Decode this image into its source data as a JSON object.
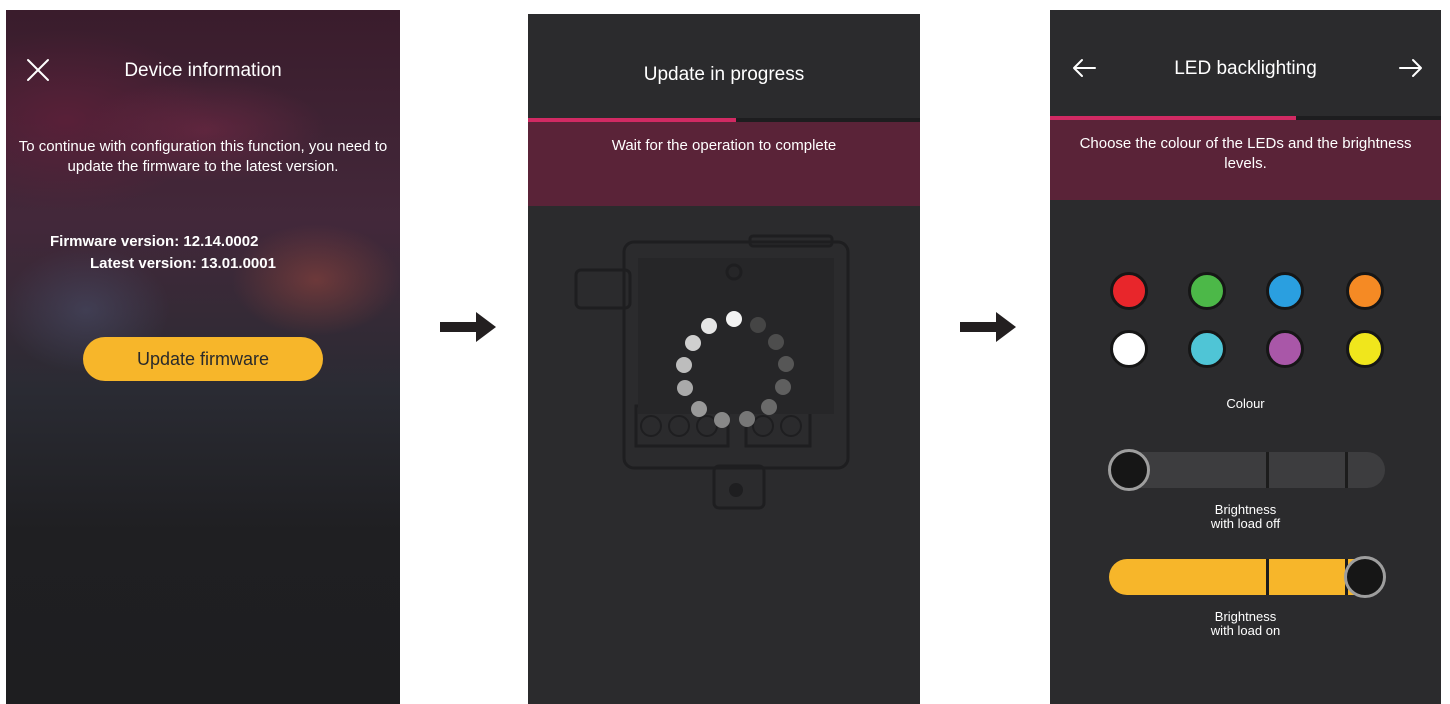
{
  "screen1": {
    "title": "Device information",
    "message": "To continue with configuration this function, you need to update the firmware to the latest version.",
    "firmware_version": "Firmware version: 12.14.0002",
    "latest_version": "Latest version: 13.01.0001",
    "update_button": "Update firmware",
    "close_icon": "close-icon"
  },
  "screen2": {
    "title": "Update in progress",
    "banner_text": "Wait for the operation to complete",
    "progress": 0.53,
    "spinner_icon": "loading-spinner-icon"
  },
  "screen3": {
    "title": "LED backlighting",
    "instructions": "Choose the colour of the LEDs and the brightness levels.",
    "progress": 0.63,
    "back_icon": "arrow-left-icon",
    "next_icon": "arrow-right-icon",
    "colour_label": "Colour",
    "colours": [
      "#e8262b",
      "#4cb848",
      "#2a9fe0",
      "#f58a24",
      "#ffffff",
      "#4fc5d6",
      "#a957a8",
      "#f0e61c"
    ],
    "brightness_off_label_1": "Brightness",
    "brightness_off_label_2": "with load off",
    "brightness_off_level": 0,
    "brightness_on_label_1": "Brightness",
    "brightness_on_label_2": "with load on",
    "brightness_on_level": 1
  },
  "flow_arrow_icon": "arrow-right-icon",
  "accent_color": "#d12a63",
  "button_color": "#f7b62a"
}
